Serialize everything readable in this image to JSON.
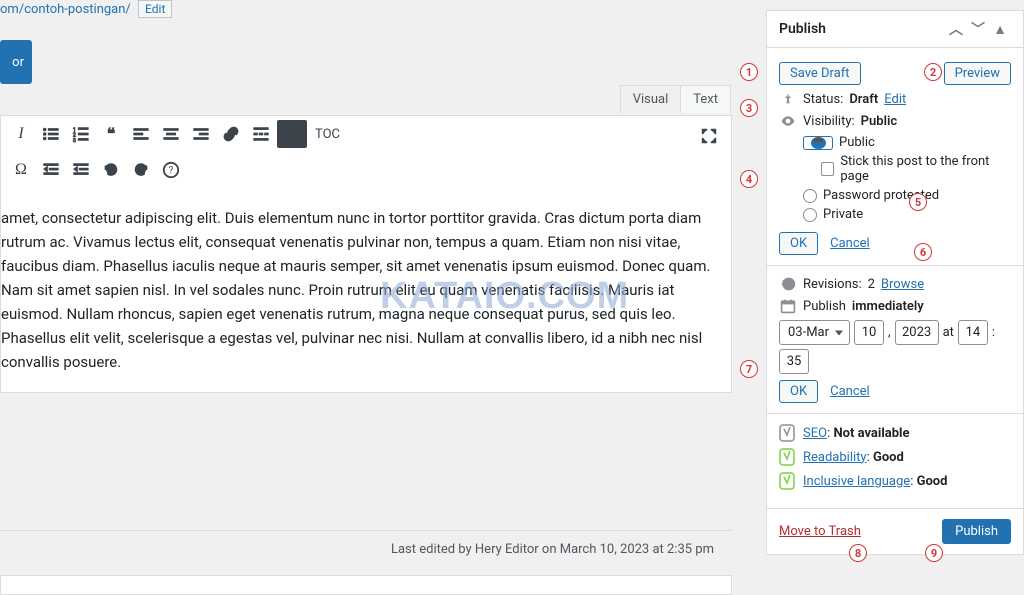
{
  "permalink": {
    "slug": "om/contoh-postingan/",
    "edit": "Edit"
  },
  "big_button": "or",
  "tabs": {
    "visual": "Visual",
    "text": "Text"
  },
  "toolbar": {
    "toc": "TOC"
  },
  "content": {
    "text": " amet, consectetur adipiscing elit. Duis elementum nunc in tortor porttitor gravida. Cras dictum porta diam rutrum ac. Vivamus lectus elit, consequat venenatis pulvinar non, tempus a quam. Etiam non nisi vitae, faucibus diam. Phasellus iaculis neque at mauris semper, sit amet venenatis ipsum euismod. Donec quam. Nam sit amet sapien nisl. In vel sodales nunc. Proin rutrum elit eu quam venenatis facilisis. Mauris iat euismod. Nullam rhoncus, sapien eget venenatis rutrum, magna neque consequat purus, sed  quis leo. Phasellus elit velit, scelerisque a egestas vel, pulvinar nec nisi. Nullam at convallis libero, id a nibh nec nisl convallis posuere."
  },
  "watermark": "KATAIO.COM",
  "last_edit": "Last edited by Hery Editor on March 10, 2023 at 2:35 pm",
  "publish": {
    "title": "Publish",
    "save_draft": "Save Draft",
    "preview": "Preview",
    "status_label": "Status:",
    "status_value": "Draft",
    "edit": "Edit",
    "visibility_label": "Visibility:",
    "visibility_value": "Public",
    "vis_public": "Public",
    "vis_stick": "Stick this post to the front page",
    "vis_password": "Password protected",
    "vis_private": "Private",
    "ok": "OK",
    "cancel": "Cancel",
    "revisions_label": "Revisions:",
    "revisions_count": "2",
    "browse": "Browse",
    "publish_label": "Publish",
    "immediately": "immediately",
    "month": "03-Mar",
    "day": "10",
    "year": "2023",
    "at": "at",
    "hour": "14",
    "min": "35",
    "seo_label": "SEO",
    "seo_value": "Not available",
    "readability_label": "Readability",
    "readability_value": "Good",
    "inclusive_label": "Inclusive language",
    "inclusive_value": "Good",
    "trash": "Move to Trash",
    "publish_btn": "Publish"
  }
}
